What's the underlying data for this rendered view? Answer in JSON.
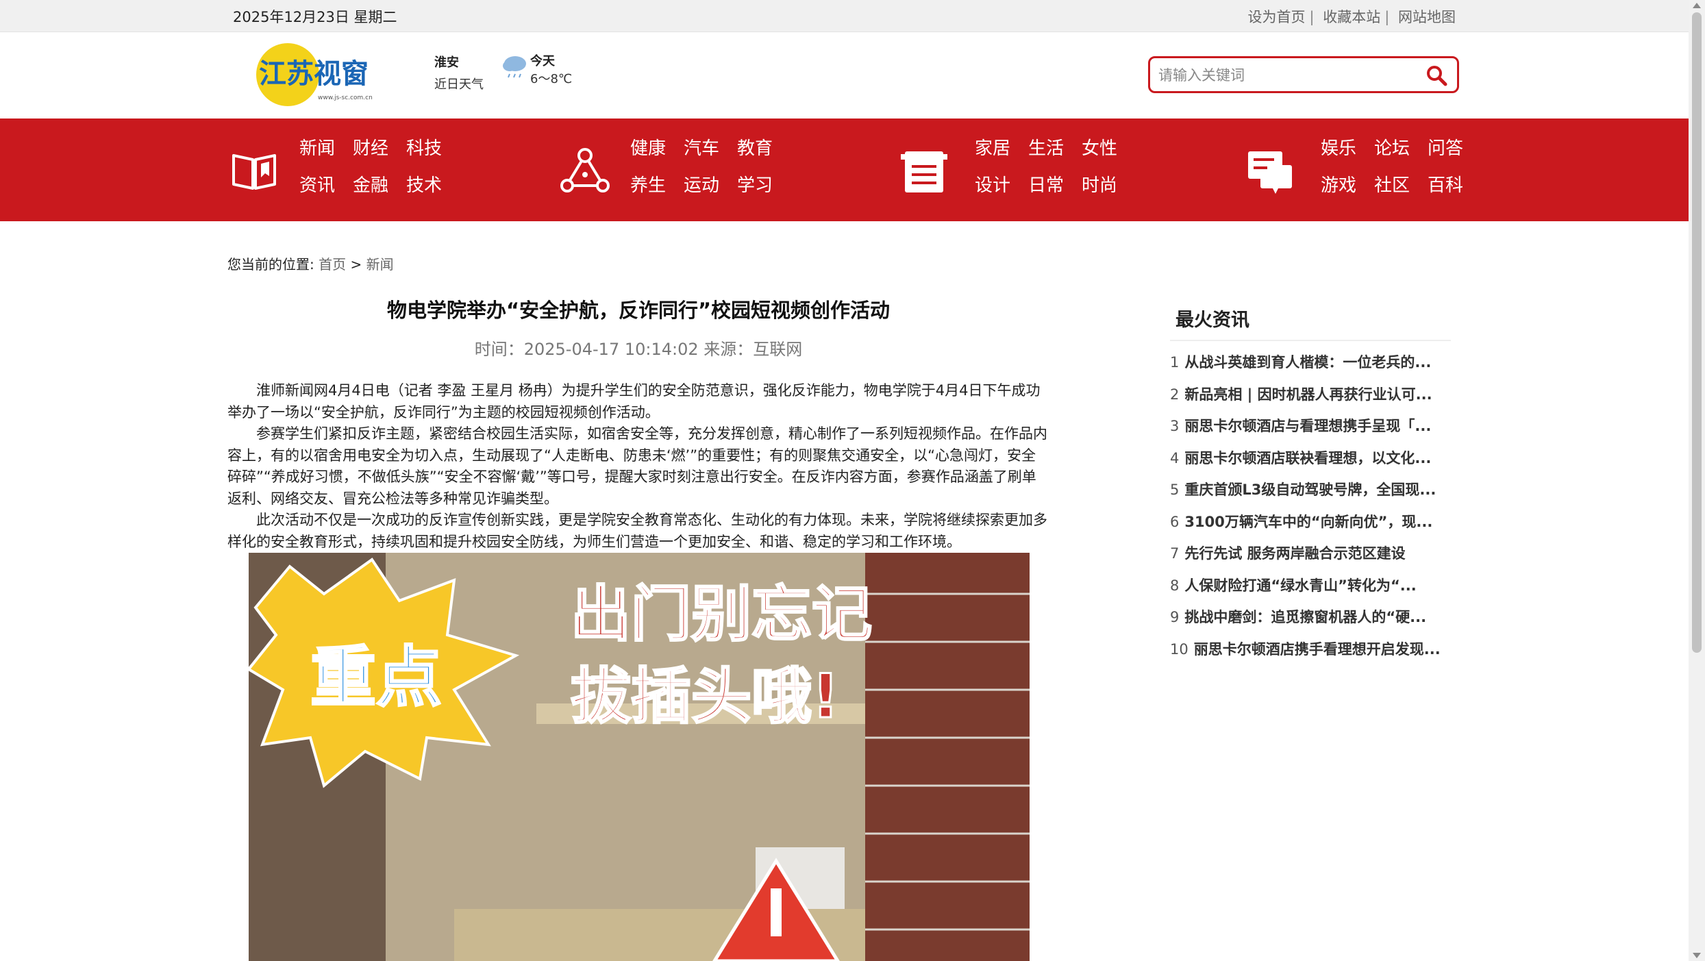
{
  "topbar": {
    "date": "2025年12月23日 星期二",
    "set_home": "设为首页",
    "bookmark": "收藏本站",
    "sitemap": "网站地图",
    "separator": "|"
  },
  "header": {
    "logo_text": "江苏视窗",
    "logo_url_text": "www.js-sc.com.cn",
    "weather": {
      "city": "淮安",
      "label": "近日天气",
      "day": "今天",
      "temp": "6～8℃"
    },
    "search_placeholder": "请输入关键词"
  },
  "nav": {
    "groups": [
      {
        "icon": "book-icon",
        "items": [
          "新闻",
          "财经",
          "科技",
          "资讯",
          "金融",
          "技术"
        ]
      },
      {
        "icon": "network-icon",
        "items": [
          "健康",
          "汽车",
          "教育",
          "养生",
          "运动",
          "学习"
        ]
      },
      {
        "icon": "box-icon",
        "items": [
          "家居",
          "生活",
          "女性",
          "设计",
          "日常",
          "时尚"
        ]
      },
      {
        "icon": "chat-icon",
        "items": [
          "娱乐",
          "论坛",
          "问答",
          "游戏",
          "社区",
          "百科"
        ]
      }
    ]
  },
  "breadcrumb": {
    "prefix": "您当前的位置:",
    "home": "首页",
    "sep": ">",
    "current": "新闻"
  },
  "article": {
    "title": "物电学院举办“安全护航，反诈同行”校园短视频创作活动",
    "meta": "时间：2025-04-17 10:14:02 来源：互联网",
    "paragraphs": [
      "淮师新闻网4月4日电（记者 李盈 王星月 杨冉）为提升学生们的安全防范意识，强化反诈能力，物电学院于4月4日下午成功举办了一场以“安全护航，反诈同行”为主题的校园短视频创作活动。",
      "参赛学生们紧扣反诈主题，紧密结合校园生活实际，如宿舍安全等，充分发挥创意，精心制作了一系列短视频作品。在作品内容上，有的以宿舍用电安全为切入点，生动展现了“人走断电、防患未‘燃’”的重要性；有的则聚焦交通安全，以“心急闯灯，安全碎碎”“养成好习惯，不做低头族”“安全不容懈‘戴’”等口号，提醒大家时刻注意出行安全。在反诈内容方面，参赛作品涵盖了刷单返利、网络交友、冒充公检法等多种常见诈骗类型。",
      "此次活动不仅是一次成功的反诈宣传创新实践，更是学院安全教育常态化、生动化的有力体现。未来，学院将继续探索更加多样化的安全教育形式，持续巩固和提升校园安全防线，为师生们营造一个更加安全、和谐、稳定的学习和工作环境。"
    ],
    "image": {
      "badge_text": "重点",
      "caption_line1": "出门别忘记",
      "caption_line2": "拔插头哦!"
    }
  },
  "sidebar": {
    "title": "最火资讯",
    "items": [
      {
        "num": "1",
        "text": "从战斗英雄到育人楷模：一位老兵的..."
      },
      {
        "num": "2",
        "text": "新品亮相 | 因时机器人再获行业认可..."
      },
      {
        "num": "3",
        "text": "丽思卡尔顿酒店与看理想携手呈现「..."
      },
      {
        "num": "4",
        "text": "丽思卡尔顿酒店联袂看理想，以文化..."
      },
      {
        "num": "5",
        "text": "重庆首颁L3级自动驾驶号牌，全国现..."
      },
      {
        "num": "6",
        "text": "3100万辆汽车中的“向新向优”，现..."
      },
      {
        "num": "7",
        "text": "先行先试 服务两岸融合示范区建设"
      },
      {
        "num": "8",
        "text": "人保财险打通“绿水青山”转化为“..."
      },
      {
        "num": "9",
        "text": "挑战中磨剑：追觅擦窗机器人的“硬..."
      },
      {
        "num": "10",
        "text": "丽思卡尔顿酒店携手看理想开启发现..."
      }
    ]
  },
  "colors": {
    "brand_red": "#c9191e",
    "logo_yellow": "#f3d21a",
    "logo_blue": "#1b66b5"
  }
}
